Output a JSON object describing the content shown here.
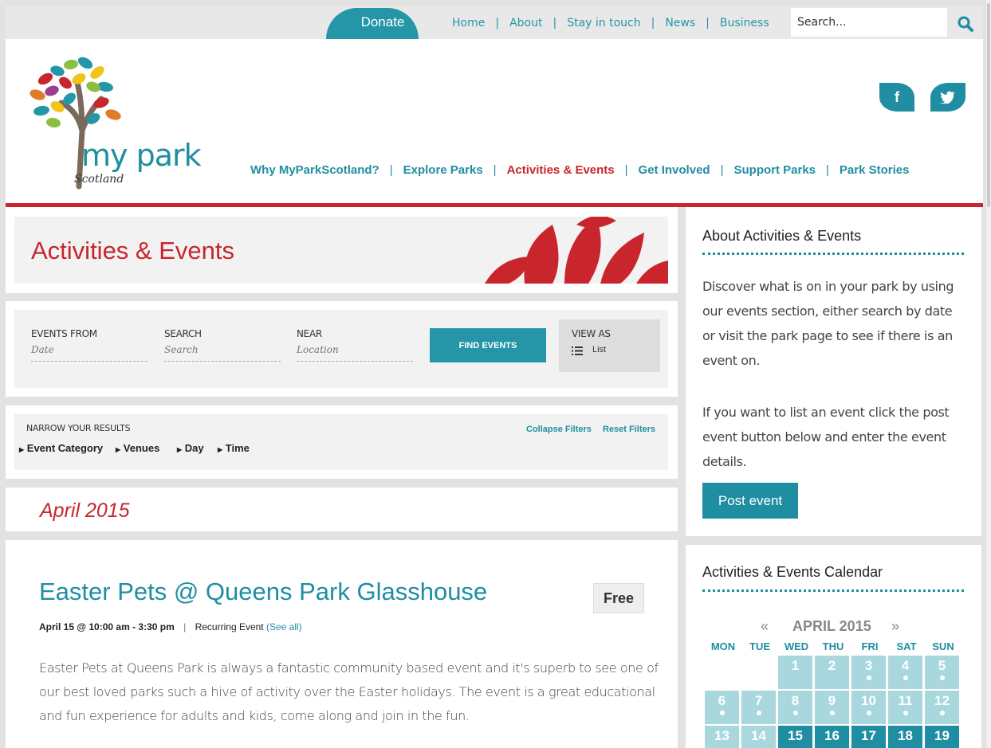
{
  "topbar": {
    "donate_label": "Donate",
    "nav": [
      "Home",
      "About",
      "Stay in touch",
      "News",
      "Business"
    ],
    "search_placeholder": "Search..."
  },
  "header": {
    "logo_word": "my park",
    "logo_sub": "Scotland",
    "social": {
      "facebook": "f",
      "twitter": "t"
    },
    "nav": [
      "Why MyParkScotland?",
      "Explore Parks",
      "Activities & Events",
      "Get Involved",
      "Support Parks",
      "Park Stories"
    ],
    "active_nav": "Activities & Events"
  },
  "page": {
    "title": "Activities & Events"
  },
  "filters": {
    "events_from_label": "EVENTS FROM",
    "events_from_placeholder": "Date",
    "search_label": "SEARCH",
    "search_placeholder": "Search",
    "near_label": "NEAR",
    "near_placeholder": "Location",
    "find_label": "FIND EVENTS",
    "view_as_label": "VIEW AS",
    "view_as_value": "List",
    "narrow_label": "NARROW YOUR RESULTS",
    "collapse_label": "Collapse Filters",
    "reset_label": "Reset Filters",
    "categories": [
      "Event Category",
      "Venues",
      "Day",
      "Time"
    ]
  },
  "listing": {
    "month": "April 2015",
    "event": {
      "title": "Easter Pets @ Queens Park Glasshouse",
      "price": "Free",
      "when": "April 15 @ 10:00 am - 3:30 pm",
      "sep": "|",
      "recurring": "Recurring Event",
      "see_all": "(See all)",
      "description": "Easter Pets at Queens Park is always a fantastic community based event and it's superb to see one of our best loved parks such a hive of activity over the Easter holidays.  The event is a great educational and fun experience for adults and kids, come along and join in the fun."
    }
  },
  "sidebar": {
    "about_heading": "About Activities & Events",
    "about_p1": "Discover what is on in your park by using our events section, either search by date or visit the park page to see if there is an event on.",
    "about_p2": "If you want to list an event click the post event button below and enter the event details.",
    "post_label": "Post event",
    "calendar_heading": "Activities & Events Calendar",
    "calendar": {
      "prev": "«",
      "month": "APRIL 2015",
      "next": "»",
      "weekdays": [
        "MON",
        "TUE",
        "WED",
        "THU",
        "FRI",
        "SAT",
        "SUN"
      ],
      "days": [
        {
          "d": "1",
          "col": 2,
          "row": 0,
          "dark": false,
          "dot": false
        },
        {
          "d": "2",
          "col": 3,
          "row": 0,
          "dark": false,
          "dot": false
        },
        {
          "d": "3",
          "col": 4,
          "row": 0,
          "dark": false,
          "dot": true
        },
        {
          "d": "4",
          "col": 5,
          "row": 0,
          "dark": false,
          "dot": true
        },
        {
          "d": "5",
          "col": 6,
          "row": 0,
          "dark": false,
          "dot": true
        },
        {
          "d": "6",
          "col": 0,
          "row": 1,
          "dark": false,
          "dot": true
        },
        {
          "d": "7",
          "col": 1,
          "row": 1,
          "dark": false,
          "dot": true
        },
        {
          "d": "8",
          "col": 2,
          "row": 1,
          "dark": false,
          "dot": true
        },
        {
          "d": "9",
          "col": 3,
          "row": 1,
          "dark": false,
          "dot": true
        },
        {
          "d": "10",
          "col": 4,
          "row": 1,
          "dark": false,
          "dot": true
        },
        {
          "d": "11",
          "col": 5,
          "row": 1,
          "dark": false,
          "dot": true
        },
        {
          "d": "12",
          "col": 6,
          "row": 1,
          "dark": false,
          "dot": true
        },
        {
          "d": "13",
          "col": 0,
          "row": 2,
          "dark": false,
          "dot": false
        },
        {
          "d": "14",
          "col": 1,
          "row": 2,
          "dark": false,
          "dot": false
        },
        {
          "d": "15",
          "col": 2,
          "row": 2,
          "dark": true,
          "dot": false
        },
        {
          "d": "16",
          "col": 3,
          "row": 2,
          "dark": true,
          "dot": false
        },
        {
          "d": "17",
          "col": 4,
          "row": 2,
          "dark": true,
          "dot": false
        },
        {
          "d": "18",
          "col": 5,
          "row": 2,
          "dark": true,
          "dot": false
        },
        {
          "d": "19",
          "col": 6,
          "row": 2,
          "dark": true,
          "dot": false
        }
      ]
    }
  },
  "colors": {
    "teal": "#1f8ea2",
    "red": "#c8262c",
    "light_teal": "#a8d7de"
  }
}
